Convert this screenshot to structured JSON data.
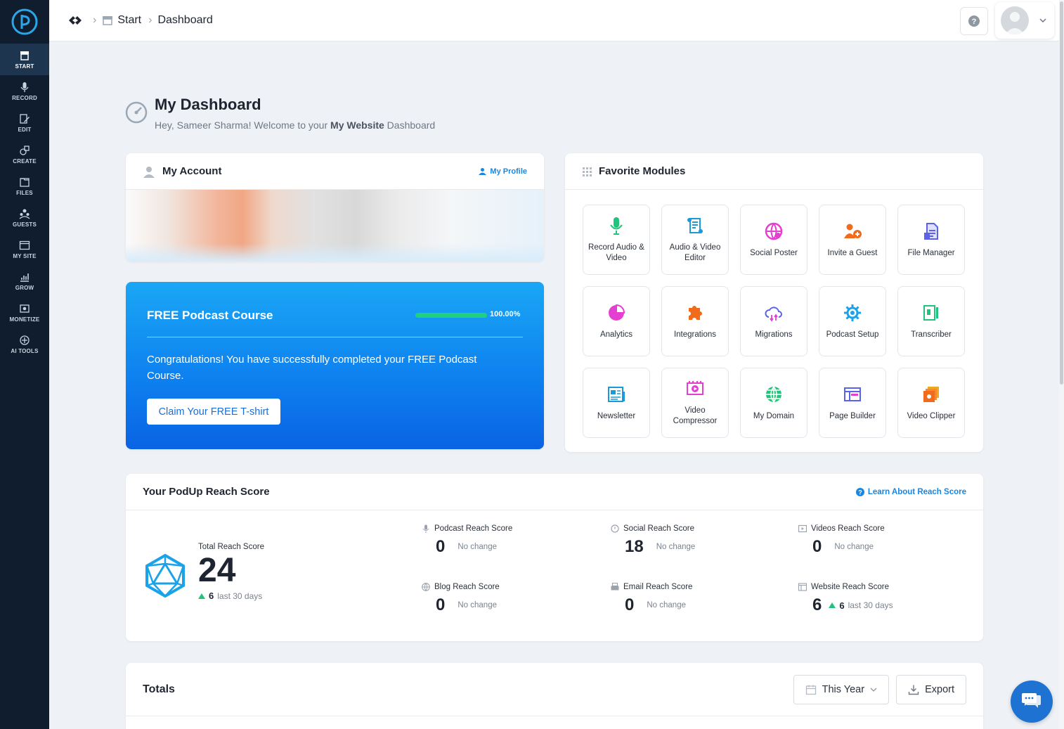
{
  "sidebar": {
    "items": [
      {
        "label": "START",
        "icon": "store-icon"
      },
      {
        "label": "RECORD",
        "icon": "microphone-icon"
      },
      {
        "label": "EDIT",
        "icon": "edit-icon"
      },
      {
        "label": "CREATE",
        "icon": "create-icon"
      },
      {
        "label": "FILES",
        "icon": "files-icon"
      },
      {
        "label": "GUESTS",
        "icon": "guests-icon"
      },
      {
        "label": "MY SITE",
        "icon": "site-icon"
      },
      {
        "label": "GROW",
        "icon": "chart-icon"
      },
      {
        "label": "MONETIZE",
        "icon": "money-icon"
      },
      {
        "label": "AI TOOLS",
        "icon": "ai-icon"
      }
    ]
  },
  "breadcrumb": {
    "start": "Start",
    "current": "Dashboard"
  },
  "header": {
    "title": "My Dashboard",
    "subtitle_prefix": "Hey, Sameer Sharma! Welcome to your ",
    "subtitle_site": "My Website",
    "subtitle_suffix": " Dashboard"
  },
  "account": {
    "title": "My Account",
    "profile_link": "My Profile"
  },
  "course": {
    "title": "FREE Podcast Course",
    "progress_pct": "100.00%",
    "progress_value": 1.0,
    "message": "Congratulations! You have successfully completed your FREE Podcast Course.",
    "button": "Claim Your FREE T-shirt"
  },
  "favorites": {
    "title": "Favorite Modules",
    "modules": [
      {
        "label": "Record Audio & Video",
        "icon": "microphone-icon"
      },
      {
        "label": "Audio & Video Editor",
        "icon": "editor-icon"
      },
      {
        "label": "Social Poster",
        "icon": "social-icon"
      },
      {
        "label": "Invite a Guest",
        "icon": "invite-icon"
      },
      {
        "label": "File Manager",
        "icon": "file-icon"
      },
      {
        "label": "Analytics",
        "icon": "pie-icon"
      },
      {
        "label": "Integrations",
        "icon": "puzzle-icon"
      },
      {
        "label": "Migrations",
        "icon": "cloud-icon"
      },
      {
        "label": "Podcast Setup",
        "icon": "gear-icon"
      },
      {
        "label": "Transcriber",
        "icon": "transcriber-icon"
      },
      {
        "label": "Newsletter",
        "icon": "newsletter-icon"
      },
      {
        "label": "Video Compressor",
        "icon": "video-icon"
      },
      {
        "label": "My Domain",
        "icon": "globe-icon"
      },
      {
        "label": "Page Builder",
        "icon": "page-icon"
      },
      {
        "label": "Video Clipper",
        "icon": "clipper-icon"
      }
    ]
  },
  "reach": {
    "title": "Your PodUp Reach Score",
    "learn_link": "Learn About Reach Score",
    "total_label": "Total Reach Score",
    "total_value": "24",
    "total_delta": "6",
    "total_delta_label": "last 30 days",
    "scores": [
      {
        "label": "Podcast Reach Score",
        "value": "0",
        "change": "No change",
        "icon": "microphone-icon"
      },
      {
        "label": "Social Reach Score",
        "value": "18",
        "change": "No change",
        "icon": "chat-icon"
      },
      {
        "label": "Videos Reach Score",
        "value": "0",
        "change": "No change",
        "icon": "video-icon"
      },
      {
        "label": "Blog Reach Score",
        "value": "0",
        "change": "No change",
        "icon": "globe-icon"
      },
      {
        "label": "Email Reach Score",
        "value": "0",
        "change": "No change",
        "icon": "printer-icon"
      },
      {
        "label": "Website Reach Score",
        "value": "6",
        "delta": "6",
        "change": "last 30 days",
        "icon": "browser-icon"
      }
    ]
  },
  "totals": {
    "title": "Totals",
    "period": "This Year",
    "export": "Export"
  }
}
